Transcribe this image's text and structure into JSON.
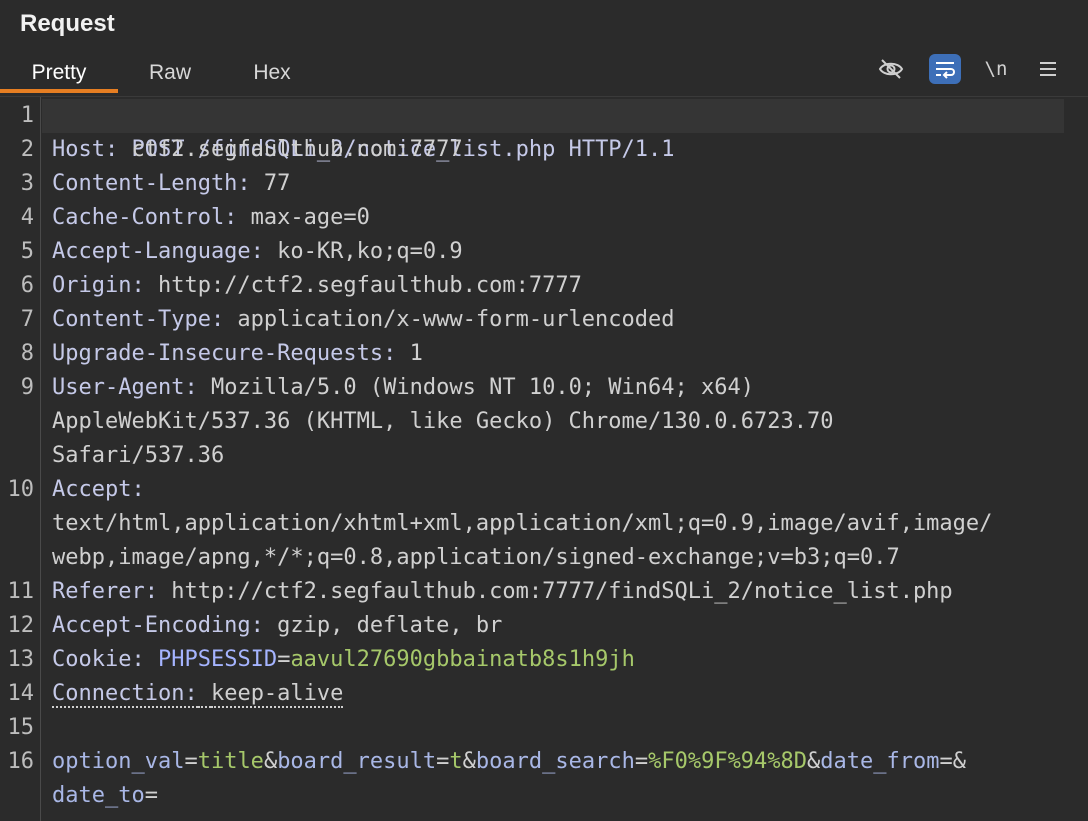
{
  "panel": {
    "title": "Request",
    "tabs": [
      "Pretty",
      "Raw",
      "Hex"
    ],
    "active_tab": "Pretty",
    "toolbar": {
      "hide_icon": "eye-slash-icon",
      "wrap_icon": "word-wrap-icon",
      "newline_label": "\\n",
      "menu_icon": "menu-icon"
    }
  },
  "editor": {
    "line_numbers": [
      "1",
      "2",
      "3",
      "4",
      "5",
      "6",
      "7",
      "8",
      "9",
      "10",
      "11",
      "12",
      "13",
      "14",
      "15",
      "16"
    ],
    "request_line": "POST /findSQLi_2/notice_list.php HTTP/1.1",
    "headers": [
      {
        "key": "Host:",
        "value": " ctf2.segfaulthub.com:7777"
      },
      {
        "key": "Content-Length:",
        "value": " 77"
      },
      {
        "key": "Cache-Control:",
        "value": " max-age=0"
      },
      {
        "key": "Accept-Language:",
        "value": " ko-KR,ko;q=0.9"
      },
      {
        "key": "Origin:",
        "value": " http://ctf2.segfaulthub.com:7777"
      },
      {
        "key": "Content-Type:",
        "value": " application/x-www-form-urlencoded"
      },
      {
        "key": "Upgrade-Insecure-Requests:",
        "value": " 1"
      },
      {
        "key": "User-Agent:",
        "value": " Mozilla/5.0 (Windows NT 10.0; Win64; x64)"
      }
    ],
    "user_agent_cont_1": "AppleWebKit/537.36 (KHTML, like Gecko) Chrome/130.0.6723.70",
    "user_agent_cont_2": "Safari/537.36",
    "accept_key": "Accept:",
    "accept_cont_1": "text/html,application/xhtml+xml,application/xml;q=0.9,image/avif,image/",
    "accept_cont_2": "webp,image/apng,*/*;q=0.8,application/signed-exchange;v=b3;q=0.7",
    "referer_key": "Referer:",
    "referer_value": " http://ctf2.segfaulthub.com:7777/findSQLi_2/notice_list.php",
    "encoding_key": "Accept-Encoding:",
    "encoding_value": " gzip, deflate, br",
    "cookie_key": "Cookie:",
    "cookie_name": "PHPSESSID",
    "cookie_value": "aavul27690gbbainatb8s1h9jh",
    "connection_key": "Connection:",
    "connection_value": "keep-alive",
    "body": {
      "p1_key": "option_val",
      "p1_val": "title",
      "p2_key": "board_result",
      "p2_val": "t",
      "p3_key": "board_search",
      "p3_val": "%F0%9F%94%8D",
      "p4_key": "date_from",
      "p5_key": "date_to"
    }
  }
}
